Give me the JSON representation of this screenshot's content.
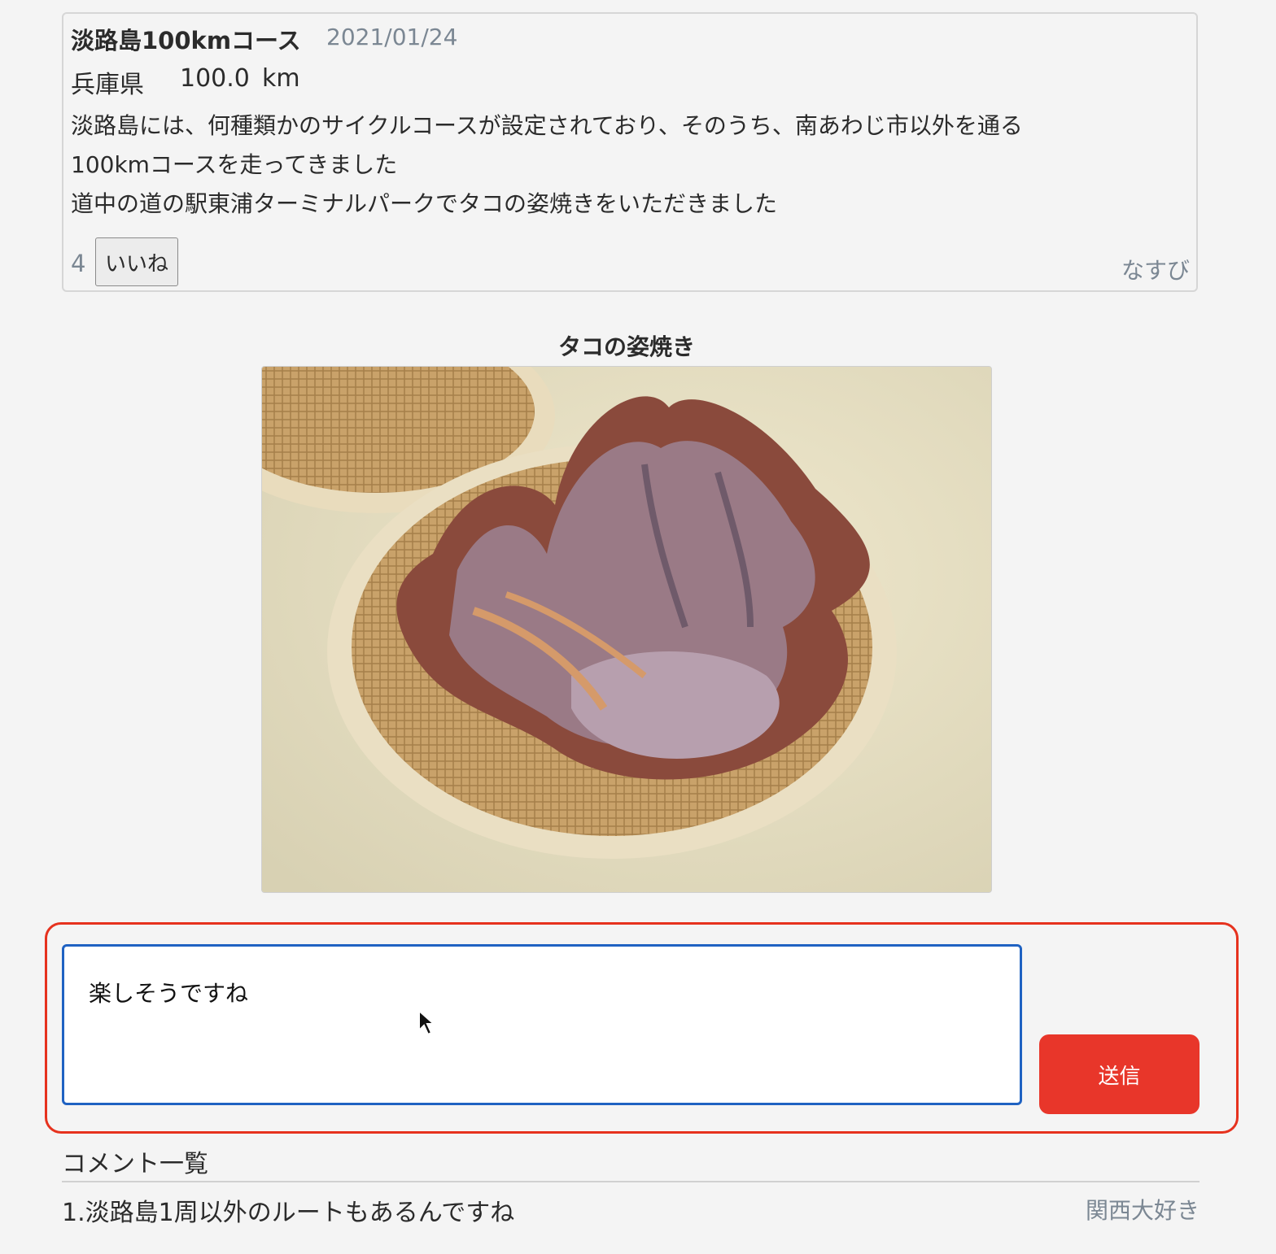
{
  "post": {
    "title": "淡路島100kmコース",
    "date": "2021/01/24",
    "prefecture": "兵庫県",
    "distance": "100.0",
    "distance_unit": "km",
    "body_lines": [
      "淡路島には、何種類かのサイクルコースが設定されており、そのうち、南あわじ市以外を通る",
      "100kmコースを走ってきました",
      "道中の道の駅東浦ターミナルパークでタコの姿焼きをいただきました"
    ],
    "like_count": "4",
    "like_label": "いいね",
    "author": "なすび"
  },
  "photo": {
    "caption": "タコの姿焼き"
  },
  "comment_form": {
    "value": "楽しそうですね",
    "submit_label": "送信",
    "highlight_color": "#e6321e"
  },
  "comments": {
    "heading": "コメント一覧",
    "items": [
      {
        "text": "1.淡路島1周以外のルートもあるんですね",
        "author": "関西大好き"
      }
    ]
  }
}
